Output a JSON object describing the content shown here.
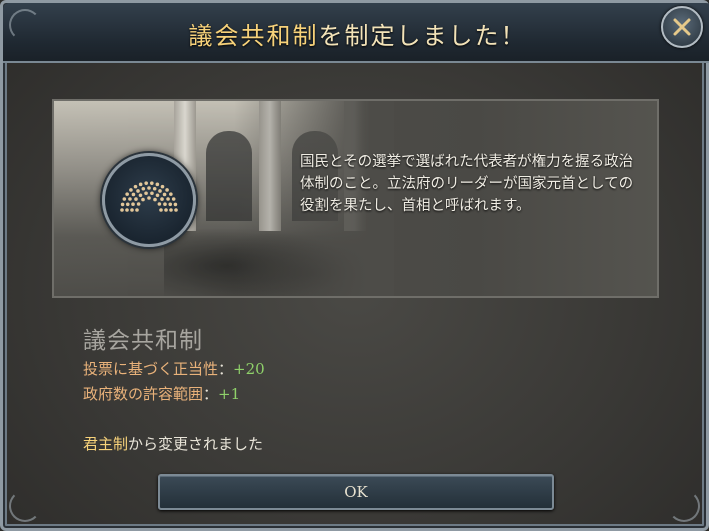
{
  "dialog": {
    "title_highlight": "議会共和制",
    "title_rest": "を制定しました！",
    "description": "国民とその選挙で選ばれた代表者が権力を握る政治体制のこと。立法府のリーダーが国家元首としての役割を果たし、首相と呼ばれます。",
    "government_name": "議会共和制",
    "stats": [
      {
        "label": "投票に基づく正当性",
        "separator": "：",
        "value": "+20"
      },
      {
        "label": "政府数の許容範囲",
        "separator": "：",
        "value": "+1"
      }
    ],
    "changed_from_highlight": "君主制",
    "changed_from_rest": "から変更されました",
    "ok_label": "OK",
    "close_icon": "close-x-icon",
    "emblem_icon": "parliament-hemicycle-icon"
  },
  "colors": {
    "title_text": "#f3e3b8",
    "stat_label": "#e9b27a",
    "stat_value": "#8fd16a",
    "highlight": "#f7d27a"
  }
}
